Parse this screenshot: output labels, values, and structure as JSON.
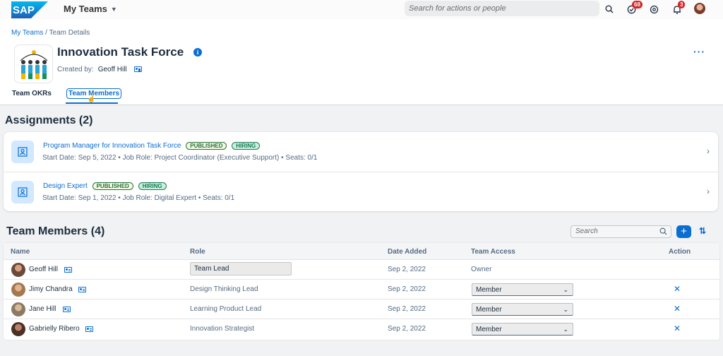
{
  "shell": {
    "logo_text": "SAP",
    "app_title": "My Teams",
    "search_placeholder": "Search for actions or people",
    "tasks_badge": "68",
    "notifications_badge": "3",
    "brand_color": "#0a6ed1"
  },
  "header": {
    "breadcrumb": {
      "link": "My Teams",
      "separator": " / ",
      "current": "Team Details"
    },
    "title": "Innovation Task Force",
    "created_label": "Created by:",
    "created_by": "Geoff Hill",
    "more_label": "···",
    "tabs": [
      {
        "label": "Team OKRs"
      },
      {
        "label": "Team Members"
      }
    ]
  },
  "assignments": {
    "title": "Assignments (2)",
    "items": [
      {
        "title": "Program Manager for Innovation Task Force",
        "tags": [
          "PUBLISHED",
          "HIRING"
        ],
        "subtitle": "Start Date: Sep 5, 2022 • Job Role: Project Coordinator (Executive Support) • Seats: 0/1"
      },
      {
        "title": "Design Expert",
        "tags": [
          "PUBLISHED",
          "HIRING"
        ],
        "subtitle": "Start Date: Sep 1, 2022 • Job Role: Digital Expert • Seats: 0/1"
      }
    ]
  },
  "members": {
    "title": "Team Members (4)",
    "search_placeholder": "Search",
    "add_label": "+",
    "sort_label": "⇅",
    "columns": [
      "Name",
      "Role",
      "Date Added",
      "Team Access",
      "Action"
    ],
    "rows": [
      {
        "name": "Geoff Hill",
        "role": "Team Lead",
        "date": "Sep 2, 2022",
        "access": "Owner",
        "avatar_color": "#6b4a3a"
      },
      {
        "name": "Jimy Chandra",
        "role": "Design Thinking Lead",
        "date": "Sep 2, 2022",
        "access": "Member",
        "avatar_color": "#a37850"
      },
      {
        "name": "Jane Hill",
        "role": "Learning Product Lead",
        "date": "Sep 2, 2022",
        "access": "Member",
        "avatar_color": "#8c7a62"
      },
      {
        "name": "Gabrielly Ribero",
        "role": "Innovation Strategist",
        "date": "Sep 2, 2022",
        "access": "Member",
        "avatar_color": "#4b3025"
      }
    ],
    "remove_label": "✕"
  }
}
